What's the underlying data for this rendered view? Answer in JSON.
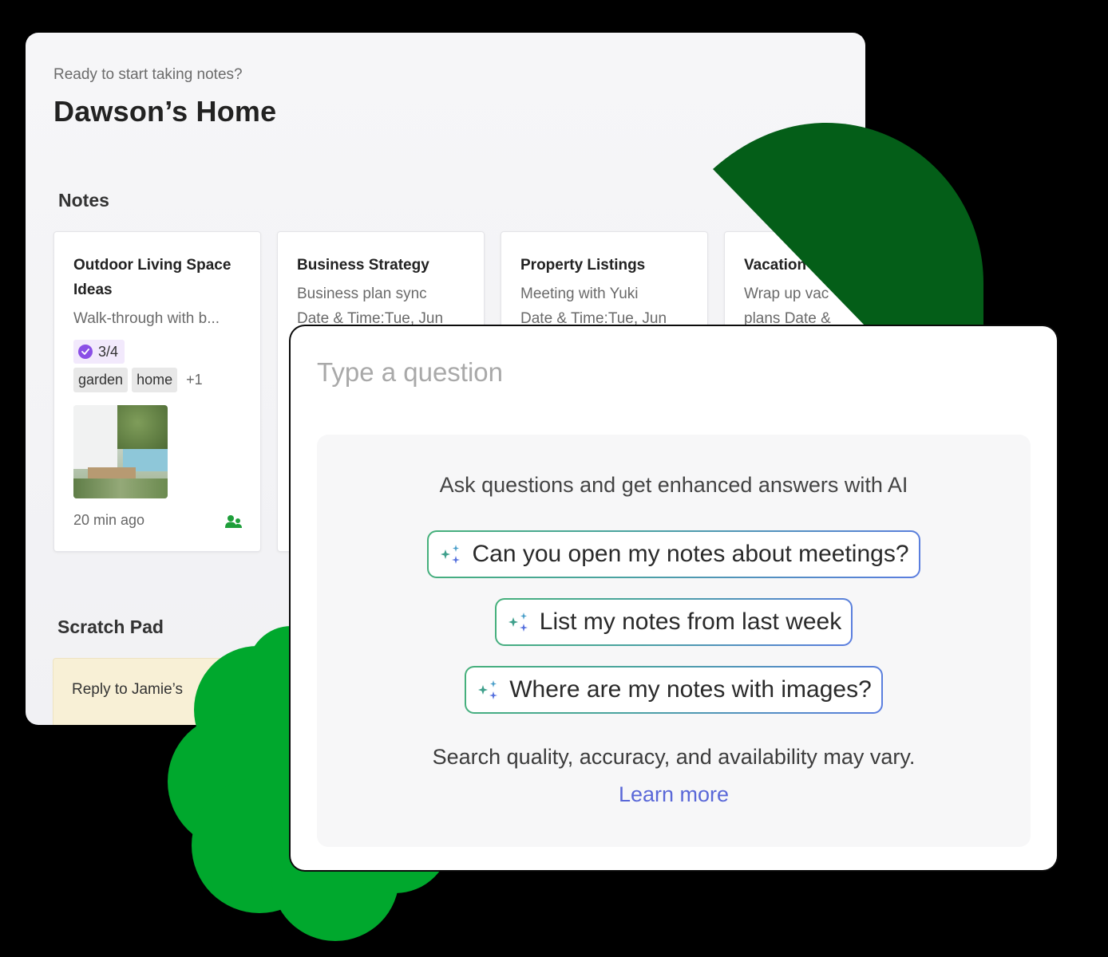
{
  "home": {
    "greeting": "Ready to start taking notes?",
    "title": "Dawson’s Home",
    "notes_heading": "Notes",
    "notes": [
      {
        "title": "Outdoor Living Space Ideas",
        "snippet_lines": [
          "Walk-through with b..."
        ],
        "tasks_progress": "3/4",
        "tags": [
          "garden",
          "home"
        ],
        "more_tags": "+1",
        "has_image": true,
        "time": "20 min ago",
        "shared_icon": "shared-users-icon"
      },
      {
        "title": "Business Strategy",
        "snippet_lines": [
          "Business plan sync",
          "Date & Time:Tue, Jun"
        ]
      },
      {
        "title": "Property Listings",
        "snippet_lines": [
          "Meeting with Yuki",
          "Date & Time:Tue, Jun"
        ]
      },
      {
        "title": "Vacation",
        "snippet_lines": [
          "Wrap up vac",
          "plans Date &"
        ]
      }
    ],
    "scratch_heading": "Scratch Pad",
    "scratch_text": "Reply to Jamie’s"
  },
  "ai": {
    "input_placeholder": "Type a question",
    "input_value": "",
    "intro": "Ask questions and get enhanced answers with AI",
    "suggestions": [
      {
        "label": "Can you open my notes about meetings?",
        "icon": "sparkle-icon"
      },
      {
        "label": "List my notes from last week",
        "icon": "sparkle-icon"
      },
      {
        "label": "Where are my notes with images?",
        "icon": "sparkle-icon"
      }
    ],
    "disclaimer": "Search quality, accuracy, and availability may vary.",
    "learn_more": "Learn more"
  },
  "colors": {
    "background": "#000000",
    "deco_dark_green": "#045e18",
    "deco_bright_green": "#00a82d",
    "task_purple": "#8a4ee6",
    "shared_green": "#1e9e3a",
    "link_blue": "#5a68d8",
    "scratch_yellow": "#f8f0d6"
  }
}
